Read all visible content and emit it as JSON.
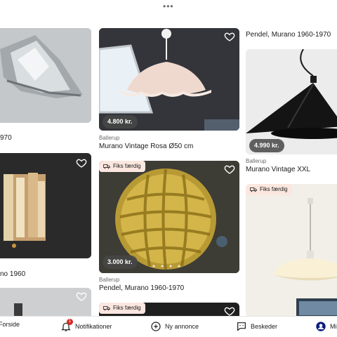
{
  "top": {
    "handle": "•••"
  },
  "listings": [
    {
      "title": "970",
      "location": "",
      "price": ""
    },
    {
      "title": "Murano Vintage Rosa Ø50 cm",
      "location": "Ballerup",
      "price": "4.800 kr."
    },
    {
      "title": "Pendel, Murano 1960-1970",
      "location": "",
      "price": ""
    },
    {
      "title": "no 1960",
      "location": "",
      "price": ""
    },
    {
      "title": "Pendel, Murano 1960-1970",
      "location": "Ballerup",
      "price": "3.000 kr.",
      "badge": "Fiks færdig"
    },
    {
      "title": "Murano Vintage XXL",
      "location": "Ballerup",
      "price": "4.990 kr."
    },
    {
      "title": "",
      "location": "",
      "price": "",
      "badge": "Fiks færdig"
    },
    {
      "title": "",
      "location": "",
      "price": "",
      "badge": "Fiks færdig"
    }
  ],
  "nav": {
    "home": "Forside",
    "notifications": "Notifikationer",
    "notifications_count": "1",
    "new_ad": "Ny annonce",
    "messages": "Beskeder",
    "profile": "Mi"
  }
}
